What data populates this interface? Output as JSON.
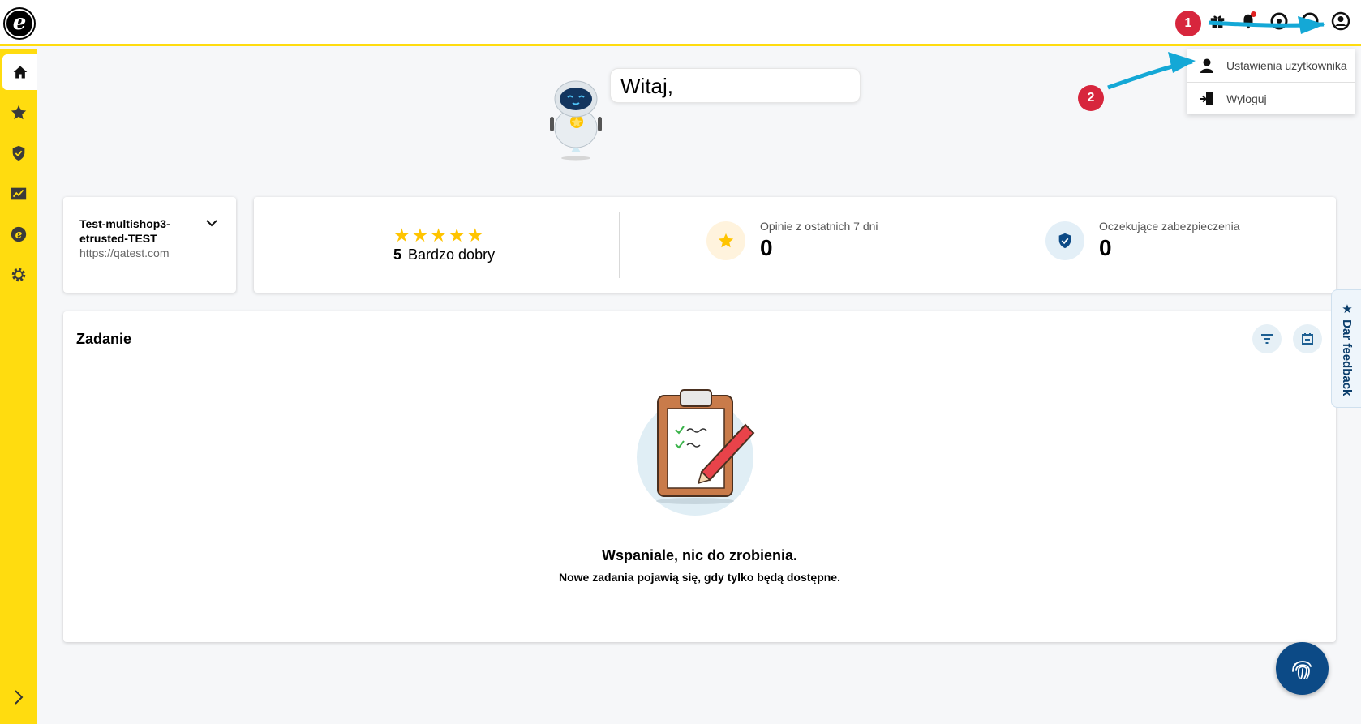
{
  "welcome": {
    "greeting": "Witaj,"
  },
  "shop": {
    "name": "Test-multishop3-etrusted-TEST",
    "url": "https://qatest.com"
  },
  "rating": {
    "stars": 5,
    "score": "5",
    "label": "Bardzo dobry"
  },
  "stats": {
    "reviews": {
      "label": "Opinie z ostatnich 7 dni",
      "value": "0"
    },
    "protections": {
      "label": "Oczekujące zabezpieczenia",
      "value": "0"
    }
  },
  "tasks": {
    "title": "Zadanie",
    "empty_title": "Wspaniale, nic do zrobienia.",
    "empty_subtitle": "Nowe zadania pojawią się, gdy tylko będą dostępne."
  },
  "feedback": {
    "label": "Dar feedback"
  },
  "user_menu": {
    "items": [
      {
        "label": "Ustawienia użytkownika",
        "icon": "user-icon"
      },
      {
        "label": "Wyloguj",
        "icon": "logout-icon"
      }
    ]
  },
  "annotations": {
    "marker_1": "1",
    "marker_2": "2"
  },
  "colors": {
    "brand_yellow": "#ffdc0f",
    "star": "#ffc400",
    "fab": "#0c4a86",
    "annotation_red": "#d7263d",
    "arrow_cyan": "#14a8d6"
  }
}
